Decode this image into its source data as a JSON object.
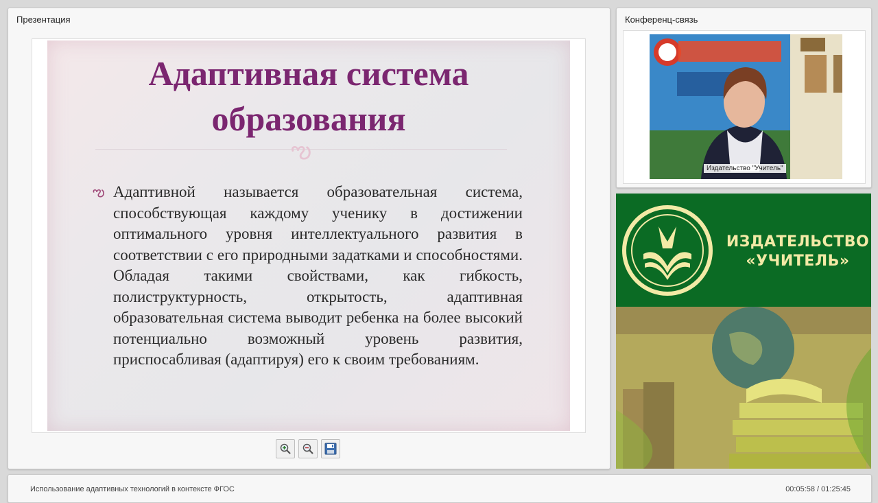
{
  "presentation": {
    "title": "Презентация",
    "slide": {
      "title_line1": "Адаптивная система",
      "title_line2": "образования",
      "ornament": "ఌ",
      "bullet_glyph": "ఌ",
      "body_text": "Адаптивной называется образовательная система, способствующая каждому ученику в достижении оптимального уровня интеллектуального развития в соответствии с его природными задатками и способностями. Обладая такими свойствами, как гибкость, полиструктурность, открытость, адаптивная образовательная система выводит ребенка на более высокий потенциально возможный уровень развития, приспосабливая (адаптируя) его к своим требованиям."
    },
    "controls": {
      "zoom_in_icon": "zoom-in-icon",
      "zoom_out_icon": "zoom-out-icon",
      "save_icon": "floppy-disk-icon"
    }
  },
  "conference": {
    "title": "Конференц-связь",
    "video_label": "Издательство \"Учитель\""
  },
  "publisher": {
    "name_line1": "ИЗДАТЕЛЬСТВО",
    "name_line2": "«УЧИТЕЛЬ»",
    "brand_green": "#0b6b24",
    "brand_gold": "#f3eaa6"
  },
  "footer": {
    "course_title": "Использование адаптивных технологий в контексте ФГОС",
    "time": "00:05:58 / 01:25:45"
  }
}
